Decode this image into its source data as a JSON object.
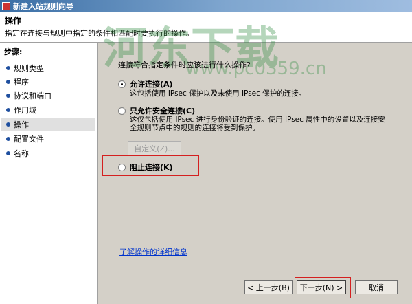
{
  "window": {
    "title": "新建入站规则向导"
  },
  "header": {
    "title": "操作",
    "description": "指定在连接与规则中指定的条件相匹配时要执行的操作。"
  },
  "watermark": {
    "text": "河东下载",
    "url": "www.pc0359.cn"
  },
  "sidebar": {
    "steps_label": "步骤:",
    "items": [
      {
        "label": "规则类型"
      },
      {
        "label": "程序"
      },
      {
        "label": "协议和端口"
      },
      {
        "label": "作用域"
      },
      {
        "label": "操作",
        "active": true
      },
      {
        "label": "配置文件"
      },
      {
        "label": "名称"
      }
    ]
  },
  "main": {
    "question": "连接符合指定条件时应该进行什么操作?",
    "options": [
      {
        "label": "允许连接(A)",
        "description": "这包括使用 IPsec 保护以及未使用 IPsec 保护的连接。",
        "checked": true
      },
      {
        "label": "只允许安全连接(C)",
        "description_line1": "这仅包括使用 IPsec 进行身份验证的连接。使用 IPsec 属性中的设置以及连接安",
        "description_line2": "全规则节点中的规则的连接将受到保护。",
        "checked": false
      },
      {
        "label": "阻止连接(K)",
        "checked": false
      }
    ],
    "customize_button": "自定义(Z)...",
    "learn_more_link": "了解操作的详细信息"
  },
  "footer": {
    "back_button": "< 上一步(B)",
    "next_button": "下一步(N) >",
    "cancel_button": "取消"
  },
  "colors": {
    "highlight": "#d42020",
    "link": "#0033cc",
    "titlebar": "#3a6ea5"
  }
}
